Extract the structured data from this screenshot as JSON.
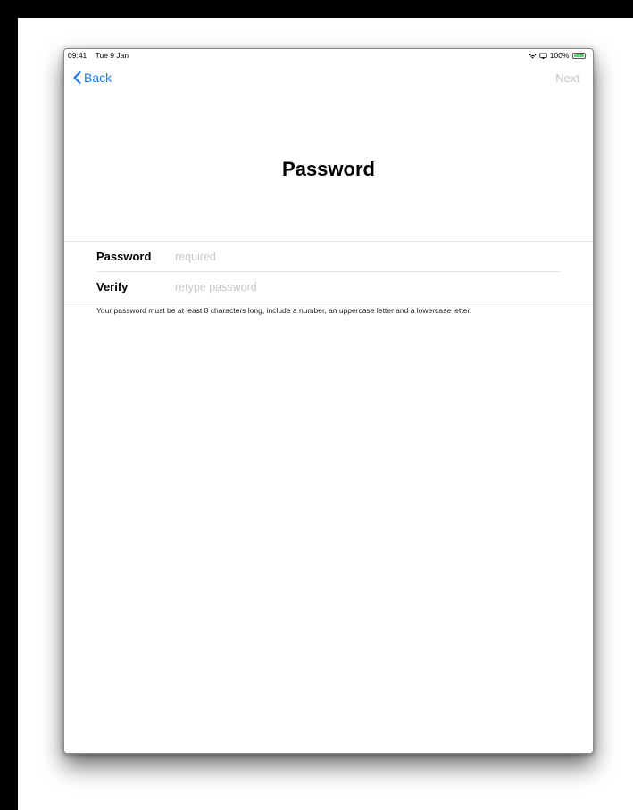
{
  "status_bar": {
    "time": "09:41",
    "date": "Tue 9 Jan",
    "battery_percent": "100%",
    "battery_level": 1.0,
    "battery_color": "#4cd964"
  },
  "nav": {
    "back_label": "Back",
    "next_label": "Next",
    "back_icon": "chevron-left-icon",
    "accent_color": "#1a7cf2"
  },
  "page": {
    "title": "Password"
  },
  "form": {
    "password": {
      "label": "Password",
      "placeholder": "required",
      "value": ""
    },
    "verify": {
      "label": "Verify",
      "placeholder": "retype password",
      "value": ""
    }
  },
  "hint": "Your password must be at least 8 characters long, include a number, an uppercase letter and a lowercase letter."
}
